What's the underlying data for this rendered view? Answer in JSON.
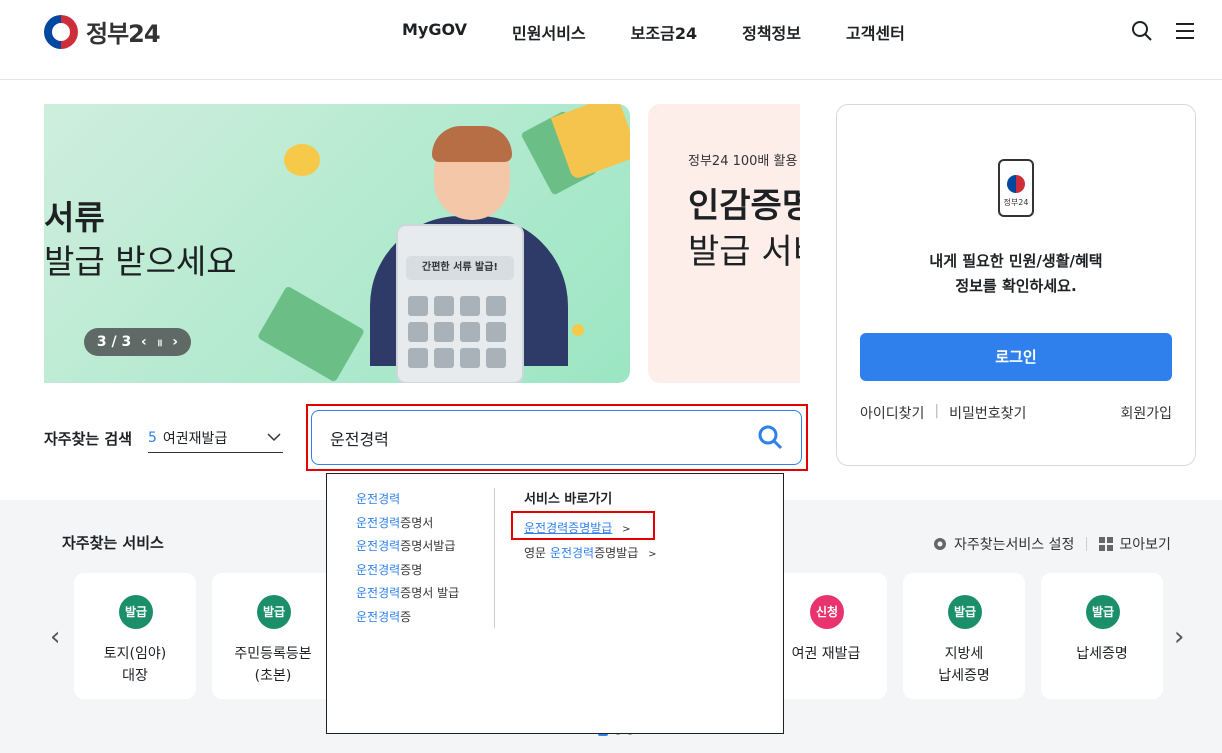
{
  "header": {
    "logo_text": "정부24",
    "nav": [
      "MyGOV",
      "민원서비스",
      "보조금24",
      "정책정보",
      "고객센터"
    ],
    "search_icon": "search-icon",
    "menu_icon": "hamburger-menu-icon"
  },
  "banner": {
    "line1": "서류",
    "line2": "발급 받으세요",
    "calc_label": "간편한 서류 발급!",
    "pager": "3 / 3",
    "prev": "‹",
    "pause": "॥",
    "next": "›"
  },
  "banner2": {
    "small": "정부24 100배 활용",
    "big1": "인감증명",
    "big2": "발급 서비"
  },
  "login": {
    "app_label": "정부24",
    "message_line1": "내게 필요한 민원/생활/혜택",
    "message_line2": "정보를 확인하세요.",
    "login_button": "로그인",
    "find_id": "아이디찾기",
    "find_pw": "비밀번호찾기",
    "join": "회원가입"
  },
  "frequent_search": {
    "label": "자주찾는 검색",
    "selected_num": "5",
    "selected_text": "여권재발급"
  },
  "search": {
    "value": "운전경력"
  },
  "autocomplete": {
    "items": [
      {
        "hl": "운전경력",
        "rest": ""
      },
      {
        "hl": "운전경력",
        "rest": "증명서"
      },
      {
        "hl": "운전경력",
        "rest": "증명서발급"
      },
      {
        "hl": "운전경력",
        "rest": "증명"
      },
      {
        "hl": "운전경력",
        "rest": "증명서 발급"
      },
      {
        "hl": "운전경력",
        "rest": "증"
      }
    ],
    "shortcut_title": "서비스 바로가기",
    "shortcut1_hl": "운전경력",
    "shortcut1_rest": "증명발급",
    "shortcut2_pre": "영문 ",
    "shortcut2_hl": "운전경력",
    "shortcut2_rest": "증명발급",
    "chevron": ">"
  },
  "services": {
    "title": "자주찾는 서비스",
    "settings": "자주찾는서비스 설정",
    "view_all": "모아보기",
    "cards": [
      {
        "badge": "발급",
        "line1": "토지(임야)",
        "line2": "대장",
        "color": "#1a8f6a"
      },
      {
        "badge": "발급",
        "line1": "주민등록등본",
        "line2": "(초본)",
        "color": "#1a8f6a"
      },
      {
        "badge": "신청",
        "line1": "여권 재발급",
        "line2": "",
        "color": "#e8336f"
      },
      {
        "badge": "발급",
        "line1": "지방세",
        "line2": "납세증명",
        "color": "#1a8f6a"
      },
      {
        "badge": "발급",
        "line1": "납세증명",
        "line2": "",
        "color": "#1a8f6a"
      }
    ],
    "prev": "‹",
    "next": "›"
  },
  "colors": {
    "primary": "#2f80ed",
    "highlight_red": "#e40000",
    "issue_green": "#1a8f6a",
    "apply_pink": "#e8336f"
  }
}
